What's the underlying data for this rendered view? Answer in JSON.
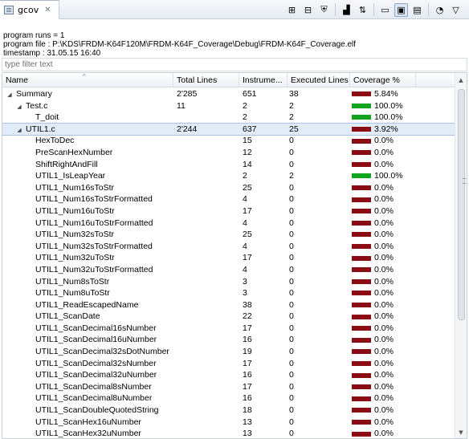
{
  "tab": {
    "title": "gcov",
    "close": "✕"
  },
  "toolbar": {
    "buttons": [
      {
        "name": "expand-all-icon",
        "glyph": "⊞"
      },
      {
        "name": "collapse-all-icon",
        "glyph": "⊟"
      },
      {
        "name": "shield-icon",
        "glyph": "⛨"
      },
      {
        "name": "chart-icon",
        "glyph": "▟"
      },
      {
        "name": "sort-icon",
        "glyph": "⇅"
      },
      {
        "name": "folder-icon",
        "glyph": "▭"
      },
      {
        "name": "summary-icon",
        "glyph": "▣"
      },
      {
        "name": "file-icon",
        "glyph": "▤"
      },
      {
        "name": "pie-chart-icon",
        "glyph": "◔"
      },
      {
        "name": "view-menu-icon",
        "glyph": "▽"
      }
    ]
  },
  "info": {
    "runs": "program runs = 1",
    "file": "program file : P:\\KDS\\FRDM-K64F120M\\FRDM-K64F_Coverage\\Debug\\FRDM-K64F_Coverage.elf",
    "timestamp": "timestamp : 31.05.15 16:40"
  },
  "filter": {
    "placeholder": "type filter text"
  },
  "columns": [
    "Name",
    "Total Lines",
    "Instrume...",
    "Executed Lines",
    "Coverage %"
  ],
  "colors": {
    "bar_red": "#8b0d14",
    "bar_green": "#10a51c",
    "selection": "#e2ecf9"
  },
  "rows": [
    {
      "name": "Summary",
      "level": 0,
      "twisty": "◢",
      "total": "2'285",
      "instr": "651",
      "exec": "38",
      "cov": "5.84%",
      "bar": "red"
    },
    {
      "name": "Test.c",
      "level": 1,
      "twisty": "◢",
      "total": "11",
      "instr": "2",
      "exec": "2",
      "cov": "100.0%",
      "bar": "green"
    },
    {
      "name": "T_doit",
      "level": 2,
      "twisty": "",
      "total": "",
      "instr": "2",
      "exec": "2",
      "cov": "100.0%",
      "bar": "green"
    },
    {
      "name": "UTIL1.c",
      "level": 1,
      "twisty": "◢",
      "total": "2'244",
      "instr": "637",
      "exec": "25",
      "cov": "3.92%",
      "bar": "red",
      "selected": true
    },
    {
      "name": "HexToDec",
      "level": 2,
      "twisty": "",
      "total": "",
      "instr": "15",
      "exec": "0",
      "cov": "0.0%",
      "bar": "red"
    },
    {
      "name": "PreScanHexNumber",
      "level": 2,
      "twisty": "",
      "total": "",
      "instr": "12",
      "exec": "0",
      "cov": "0.0%",
      "bar": "red"
    },
    {
      "name": "ShiftRightAndFill",
      "level": 2,
      "twisty": "",
      "total": "",
      "instr": "14",
      "exec": "0",
      "cov": "0.0%",
      "bar": "red"
    },
    {
      "name": "UTIL1_IsLeapYear",
      "level": 2,
      "twisty": "",
      "total": "",
      "instr": "2",
      "exec": "2",
      "cov": "100.0%",
      "bar": "green"
    },
    {
      "name": "UTIL1_Num16sToStr",
      "level": 2,
      "twisty": "",
      "total": "",
      "instr": "25",
      "exec": "0",
      "cov": "0.0%",
      "bar": "red"
    },
    {
      "name": "UTIL1_Num16sToStrFormatted",
      "level": 2,
      "twisty": "",
      "total": "",
      "instr": "4",
      "exec": "0",
      "cov": "0.0%",
      "bar": "red"
    },
    {
      "name": "UTIL1_Num16uToStr",
      "level": 2,
      "twisty": "",
      "total": "",
      "instr": "17",
      "exec": "0",
      "cov": "0.0%",
      "bar": "red"
    },
    {
      "name": "UTIL1_Num16uToStrFormatted",
      "level": 2,
      "twisty": "",
      "total": "",
      "instr": "4",
      "exec": "0",
      "cov": "0.0%",
      "bar": "red"
    },
    {
      "name": "UTIL1_Num32sToStr",
      "level": 2,
      "twisty": "",
      "total": "",
      "instr": "25",
      "exec": "0",
      "cov": "0.0%",
      "bar": "red"
    },
    {
      "name": "UTIL1_Num32sToStrFormatted",
      "level": 2,
      "twisty": "",
      "total": "",
      "instr": "4",
      "exec": "0",
      "cov": "0.0%",
      "bar": "red"
    },
    {
      "name": "UTIL1_Num32uToStr",
      "level": 2,
      "twisty": "",
      "total": "",
      "instr": "17",
      "exec": "0",
      "cov": "0.0%",
      "bar": "red"
    },
    {
      "name": "UTIL1_Num32uToStrFormatted",
      "level": 2,
      "twisty": "",
      "total": "",
      "instr": "4",
      "exec": "0",
      "cov": "0.0%",
      "bar": "red"
    },
    {
      "name": "UTIL1_Num8sToStr",
      "level": 2,
      "twisty": "",
      "total": "",
      "instr": "3",
      "exec": "0",
      "cov": "0.0%",
      "bar": "red"
    },
    {
      "name": "UTIL1_Num8uToStr",
      "level": 2,
      "twisty": "",
      "total": "",
      "instr": "3",
      "exec": "0",
      "cov": "0.0%",
      "bar": "red"
    },
    {
      "name": "UTIL1_ReadEscapedName",
      "level": 2,
      "twisty": "",
      "total": "",
      "instr": "38",
      "exec": "0",
      "cov": "0.0%",
      "bar": "red"
    },
    {
      "name": "UTIL1_ScanDate",
      "level": 2,
      "twisty": "",
      "total": "",
      "instr": "22",
      "exec": "0",
      "cov": "0.0%",
      "bar": "red"
    },
    {
      "name": "UTIL1_ScanDecimal16sNumber",
      "level": 2,
      "twisty": "",
      "total": "",
      "instr": "17",
      "exec": "0",
      "cov": "0.0%",
      "bar": "red"
    },
    {
      "name": "UTIL1_ScanDecimal16uNumber",
      "level": 2,
      "twisty": "",
      "total": "",
      "instr": "16",
      "exec": "0",
      "cov": "0.0%",
      "bar": "red"
    },
    {
      "name": "UTIL1_ScanDecimal32sDotNumber",
      "level": 2,
      "twisty": "",
      "total": "",
      "instr": "19",
      "exec": "0",
      "cov": "0.0%",
      "bar": "red"
    },
    {
      "name": "UTIL1_ScanDecimal32sNumber",
      "level": 2,
      "twisty": "",
      "total": "",
      "instr": "17",
      "exec": "0",
      "cov": "0.0%",
      "bar": "red"
    },
    {
      "name": "UTIL1_ScanDecimal32uNumber",
      "level": 2,
      "twisty": "",
      "total": "",
      "instr": "16",
      "exec": "0",
      "cov": "0.0%",
      "bar": "red"
    },
    {
      "name": "UTIL1_ScanDecimal8sNumber",
      "level": 2,
      "twisty": "",
      "total": "",
      "instr": "17",
      "exec": "0",
      "cov": "0.0%",
      "bar": "red"
    },
    {
      "name": "UTIL1_ScanDecimal8uNumber",
      "level": 2,
      "twisty": "",
      "total": "",
      "instr": "16",
      "exec": "0",
      "cov": "0.0%",
      "bar": "red"
    },
    {
      "name": "UTIL1_ScanDoubleQuotedString",
      "level": 2,
      "twisty": "",
      "total": "",
      "instr": "18",
      "exec": "0",
      "cov": "0.0%",
      "bar": "red"
    },
    {
      "name": "UTIL1_ScanHex16uNumber",
      "level": 2,
      "twisty": "",
      "total": "",
      "instr": "13",
      "exec": "0",
      "cov": "0.0%",
      "bar": "red"
    },
    {
      "name": "UTIL1_ScanHex32uNumber",
      "level": 2,
      "twisty": "",
      "total": "",
      "instr": "13",
      "exec": "0",
      "cov": "0.0%",
      "bar": "red"
    }
  ]
}
